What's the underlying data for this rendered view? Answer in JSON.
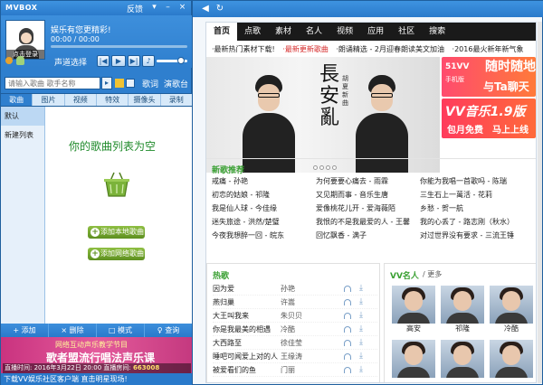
{
  "player": {
    "logo": "MVBOX",
    "feedback": "反馈",
    "window_buttons": [
      "▾",
      "–",
      "×"
    ],
    "avatar_caption": "点击登录",
    "now_playing": "娱乐有您更精彩!",
    "time": "00:00 / 00:00",
    "progress": 0.0,
    "mode_label": "声道选择",
    "volume": 0.8,
    "search_placeholder": "请输入歌曲 歌手名称",
    "search_go": "Go",
    "lyrics_label": "歌词",
    "stage_label": "演歌台",
    "tabs": [
      "歌曲",
      "图片",
      "视频",
      "特效",
      "摄像头",
      "录制"
    ],
    "playlists": [
      "默认",
      "新建列表"
    ],
    "empty_text": "你的歌曲列表为空",
    "add_local": "添加本地歌曲",
    "add_online": "添加网络歌曲",
    "bottom_buttons": [
      "+ 添加",
      "× 删除",
      "□ 模式",
      "♀ 查询"
    ],
    "banner": {
      "line1": "网络互动声乐教学节目",
      "line2": "歌者盟流行唱法声乐课",
      "time_label": "直播时间: 2016年3月22日 20:00",
      "room_label": "直播房间:",
      "room_no": "663008"
    },
    "status": "下载VV娱乐社区客户端 直击明星现场!"
  },
  "browser": {
    "nav": [
      "首页",
      "点歌",
      "素材",
      "名人",
      "视频",
      "应用",
      "社区",
      "搜索"
    ],
    "ticker": [
      "·最新热门素材下载!",
      "·最新更新歌曲",
      "·朗诵精选 - 2月迎春朗读美文加油",
      "·2016最火新年新气象"
    ],
    "hero": {
      "calligraphy": "長安亂",
      "vertical_text": "胡夏新曲"
    },
    "ads": {
      "ad1_line1": "51VV",
      "ad1_line2": "手机版",
      "ad1_big1": "随时随地",
      "ad1_big2": "与Ta聊天",
      "ad2_title": "VV音乐1.9版",
      "ad2_left": "包月免费",
      "ad2_right": "马上上线"
    },
    "new_songs_title": "新歌推荐",
    "new_songs": [
      "戒痛 - 孙艳",
      "为何要要心痛去 - 雨霖",
      "你能为我唱一首歌吗 - 陈瑞",
      "初恋的姑娘 - 祁隆",
      "又见期而事 - 音乐生唐",
      "三生石上一萬活 - 花莉",
      "我是仙人球 - 今佳缘",
      "爱像桃花儿开 - 爱海薇陌",
      "乡愁 - 贺一航",
      "迷失旅途 - 洪然/楚璧",
      "我恨的不是我最爱的人 - 王馨",
      "我的心丢了 - 路志刚（秋水）",
      "今夜我想醉一回 - 皖东",
      "回忆飘香 - 满子",
      "对过世界没有要求 - 三流王锤"
    ],
    "hot_title": "热歌",
    "hot_songs": [
      {
        "title": "因为爱",
        "singer": "孙艳"
      },
      {
        "title": "燕归巢",
        "singer": "许嵩"
      },
      {
        "title": "大王叫我来",
        "singer": "朱贝贝"
      },
      {
        "title": "你是我最美的相遇",
        "singer": "冷酷"
      },
      {
        "title": "大西路至",
        "singer": "徐佳莹"
      },
      {
        "title": "睡吧可闻爱上对的人",
        "singer": "王缘涛"
      },
      {
        "title": "被爱看们的鱼",
        "singer": "门丽"
      }
    ],
    "stars_title": "VV名人",
    "stars_more": "/ 更多",
    "stars": [
      "高安",
      "祁隆",
      "冷酷"
    ]
  }
}
